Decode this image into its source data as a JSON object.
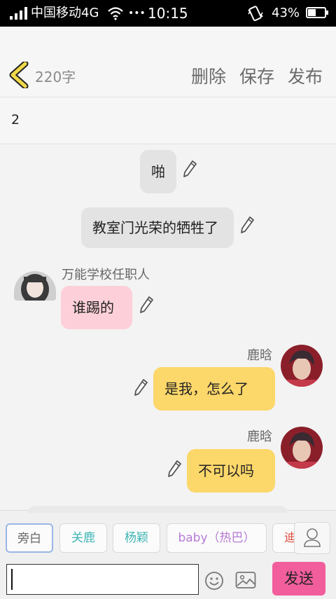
{
  "status_bar": {
    "carrier": "中国移动4G",
    "dots": "•••",
    "time": "10:15",
    "battery_percent": "43%"
  },
  "header": {
    "word_count": "220字",
    "delete_label": "删除",
    "save_label": "保存",
    "publish_label": "发布"
  },
  "title_line": "2",
  "messages": [
    {
      "type": "narration",
      "text": "啪"
    },
    {
      "type": "narration",
      "text": "教室门光荣的牺牲了"
    },
    {
      "type": "left",
      "sender": "万能学校任职人",
      "text": "谁踢的"
    },
    {
      "type": "right",
      "sender": "鹿晗",
      "text": "是我，怎么了"
    },
    {
      "type": "right",
      "sender": "鹿晗",
      "text": "不可以吗"
    }
  ],
  "character_chips": [
    {
      "label": "旁白",
      "color": "#666666"
    },
    {
      "label": "关鹿",
      "color": "#3fb5b5"
    },
    {
      "label": "杨颖",
      "color": "#3fb5b5"
    },
    {
      "label": "baby（热巴）",
      "color": "#b77ad6"
    },
    {
      "label": "迪",
      "color": "#e04a3c"
    }
  ],
  "composer": {
    "send_label": "发送"
  },
  "colors": {
    "narration_bubble": "#e3e3e3",
    "left_bubble": "#fdd0d9",
    "right_bubble": "#fcd76a",
    "send_button": "#f25d9c",
    "back_icon": "#f0d84a"
  }
}
